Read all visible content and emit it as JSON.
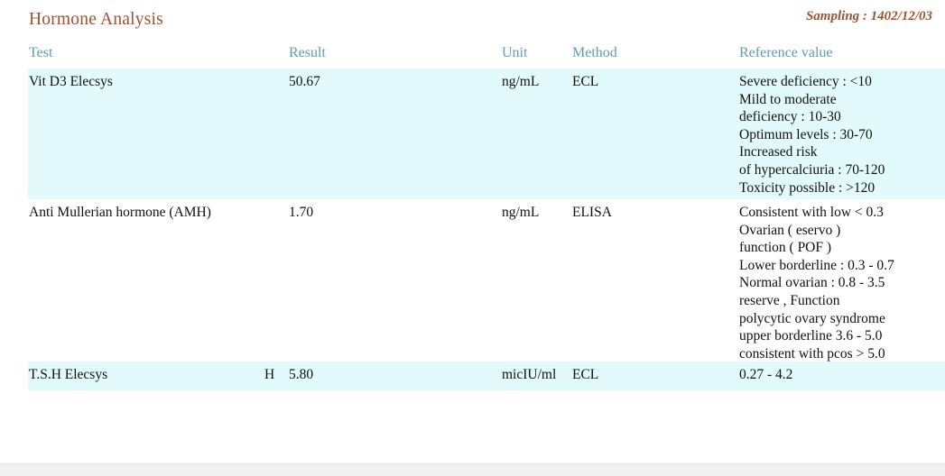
{
  "header": {
    "title": "Hormone Analysis",
    "sampling_label": "Sampling : 1402/12/03",
    "title_color": "#A0522D",
    "accent_color": "#5C9CB8"
  },
  "table": {
    "columns": [
      {
        "key": "test",
        "label": "Test"
      },
      {
        "key": "result",
        "label": "Result"
      },
      {
        "key": "unit",
        "label": "Unit"
      },
      {
        "key": "method",
        "label": "Method"
      },
      {
        "key": "ref",
        "label": "Reference value"
      }
    ],
    "rows": [
      {
        "test": "Vit D3 Elecsys",
        "flag": "",
        "result": "50.67",
        "unit": "ng/mL",
        "method": "ECL",
        "reference_value": "Severe deficiency : <10\nMild to moderate\n deficiency : 10-30\nOptimum levels : 30-70\nIncreased risk\nof hypercalciuria : 70-120\nToxicity possible : >120",
        "abnormal": false,
        "striped": true
      },
      {
        "test": "Anti Mullerian hormone (AMH)",
        "flag": "",
        "result": "1.70",
        "unit": "ng/mL",
        "method": "ELISA",
        "reference_value": "Consistent with low < 0.3\nOvarian ( eservo )\nfunction ( POF )\nLower borderline : 0.3 - 0.7\nNormal ovarian : 0.8 - 3.5\nreserve , Function\npolycytic ovary syndrome\nupper borderline 3.6 - 5.0\nconsistent with pcos > 5.0",
        "abnormal": false,
        "striped": false
      },
      {
        "test": "T.S.H Elecsys",
        "flag": "H",
        "result": "5.80",
        "unit": "micIU/ml",
        "method": "ECL",
        "reference_value": "0.27 - 4.2",
        "abnormal": true,
        "striped": true
      }
    ],
    "flag_high_color": "#E0495A",
    "abnormal_text_color": "#9B2226",
    "stripe_color": "#E2FAFB"
  }
}
